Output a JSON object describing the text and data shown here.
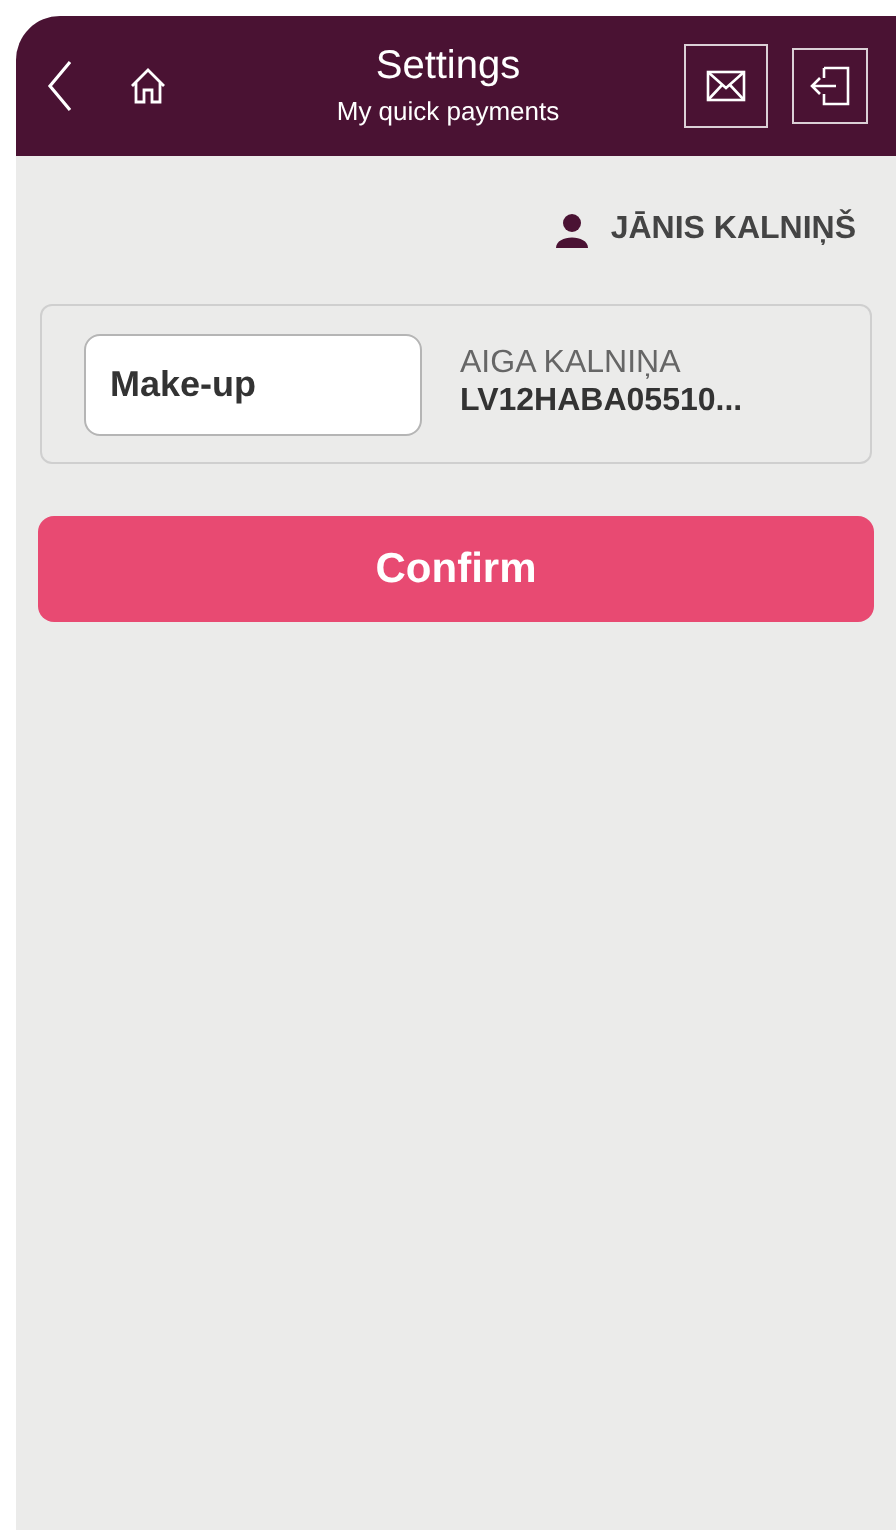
{
  "header": {
    "title": "Settings",
    "subtitle": "My quick payments"
  },
  "user": {
    "name": "JĀNIS KALNIŅŠ"
  },
  "payment": {
    "name_value": "Make-up",
    "recipient": "AIGA KALNIŅA",
    "account": "LV12HABA05510..."
  },
  "buttons": [
    "Confirm"
  ]
}
